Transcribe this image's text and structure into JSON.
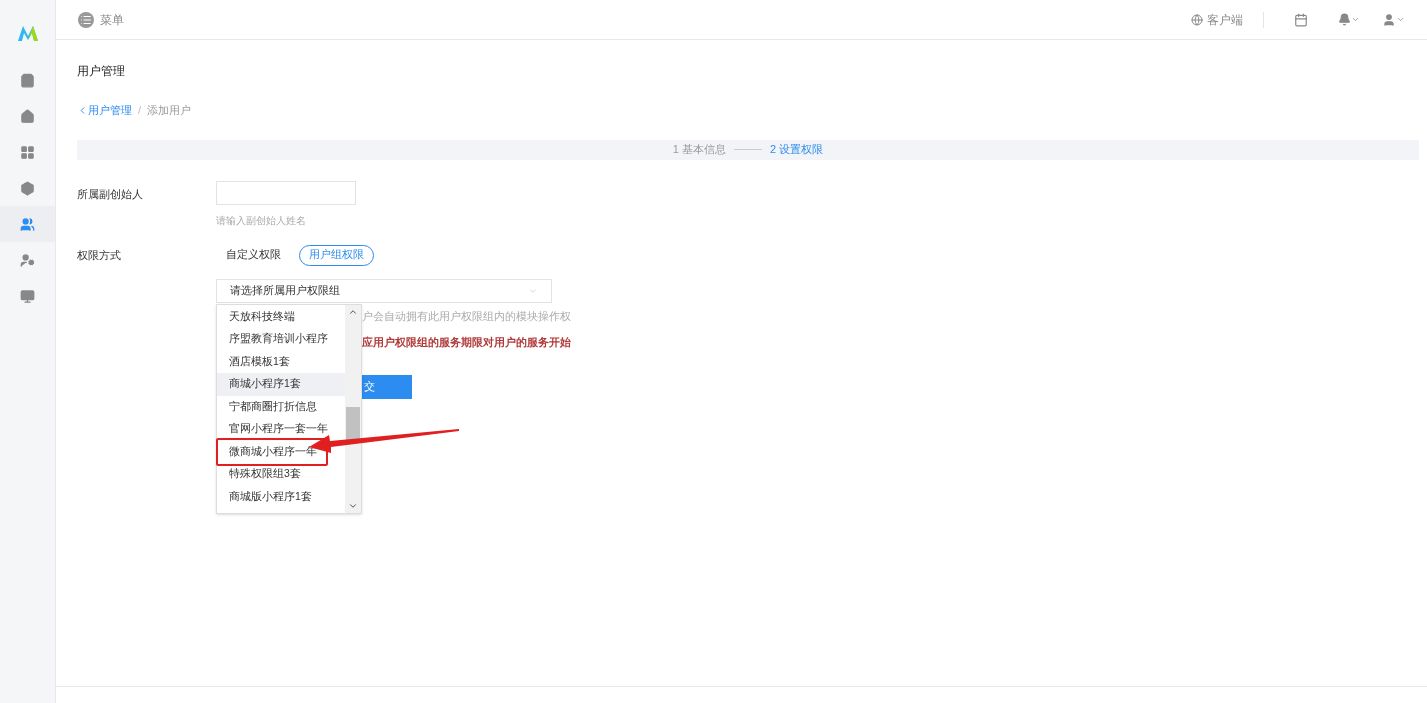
{
  "sidebar": {
    "items": [
      {
        "selected": false
      },
      {
        "selected": false
      },
      {
        "selected": false
      },
      {
        "selected": false
      },
      {
        "selected": true
      },
      {
        "selected": false
      },
      {
        "selected": false
      }
    ]
  },
  "topbar": {
    "menu_label": "菜单",
    "client_label": "客户端"
  },
  "page_title": "用户管理",
  "breadcrumb": {
    "back": "用户管理",
    "separator": "/",
    "current": "添加用户"
  },
  "steps": [
    {
      "label": "1 基本信息",
      "selected": false
    },
    {
      "label": "2 设置权限",
      "selected": true
    }
  ],
  "form": {
    "founder": {
      "label": "所属副创始人",
      "hint": "请输入副创始人姓名"
    },
    "permission": {
      "label": "权限方式",
      "options": [
        {
          "label": "自定义权限",
          "selected": false
        },
        {
          "label": "用户组权限",
          "selected": true
        }
      ]
    },
    "group_select": {
      "placeholder": "请选择所属用户权限组"
    },
    "group_hint": "户会自动拥有此用户权限组内的模块操作权",
    "warning": "应用户权限组的服务期限对用户的服务开始",
    "submit": "交"
  },
  "dropdown": {
    "items": [
      {
        "label": "天放科技终端",
        "hovered": false,
        "marked": false
      },
      {
        "label": "序盟教育培训小程序",
        "hovered": false,
        "marked": false
      },
      {
        "label": "酒店模板1套",
        "hovered": false,
        "marked": false
      },
      {
        "label": "商城小程序1套",
        "hovered": true,
        "marked": false
      },
      {
        "label": "宁都商圈打折信息",
        "hovered": false,
        "marked": false
      },
      {
        "label": "官网小程序一套一年",
        "hovered": false,
        "marked": false
      },
      {
        "label": "微商城小程序一年",
        "hovered": false,
        "marked": true
      },
      {
        "label": "特殊权限组3套",
        "hovered": false,
        "marked": false
      },
      {
        "label": "商城版小程序1套",
        "hovered": false,
        "marked": false
      }
    ]
  }
}
